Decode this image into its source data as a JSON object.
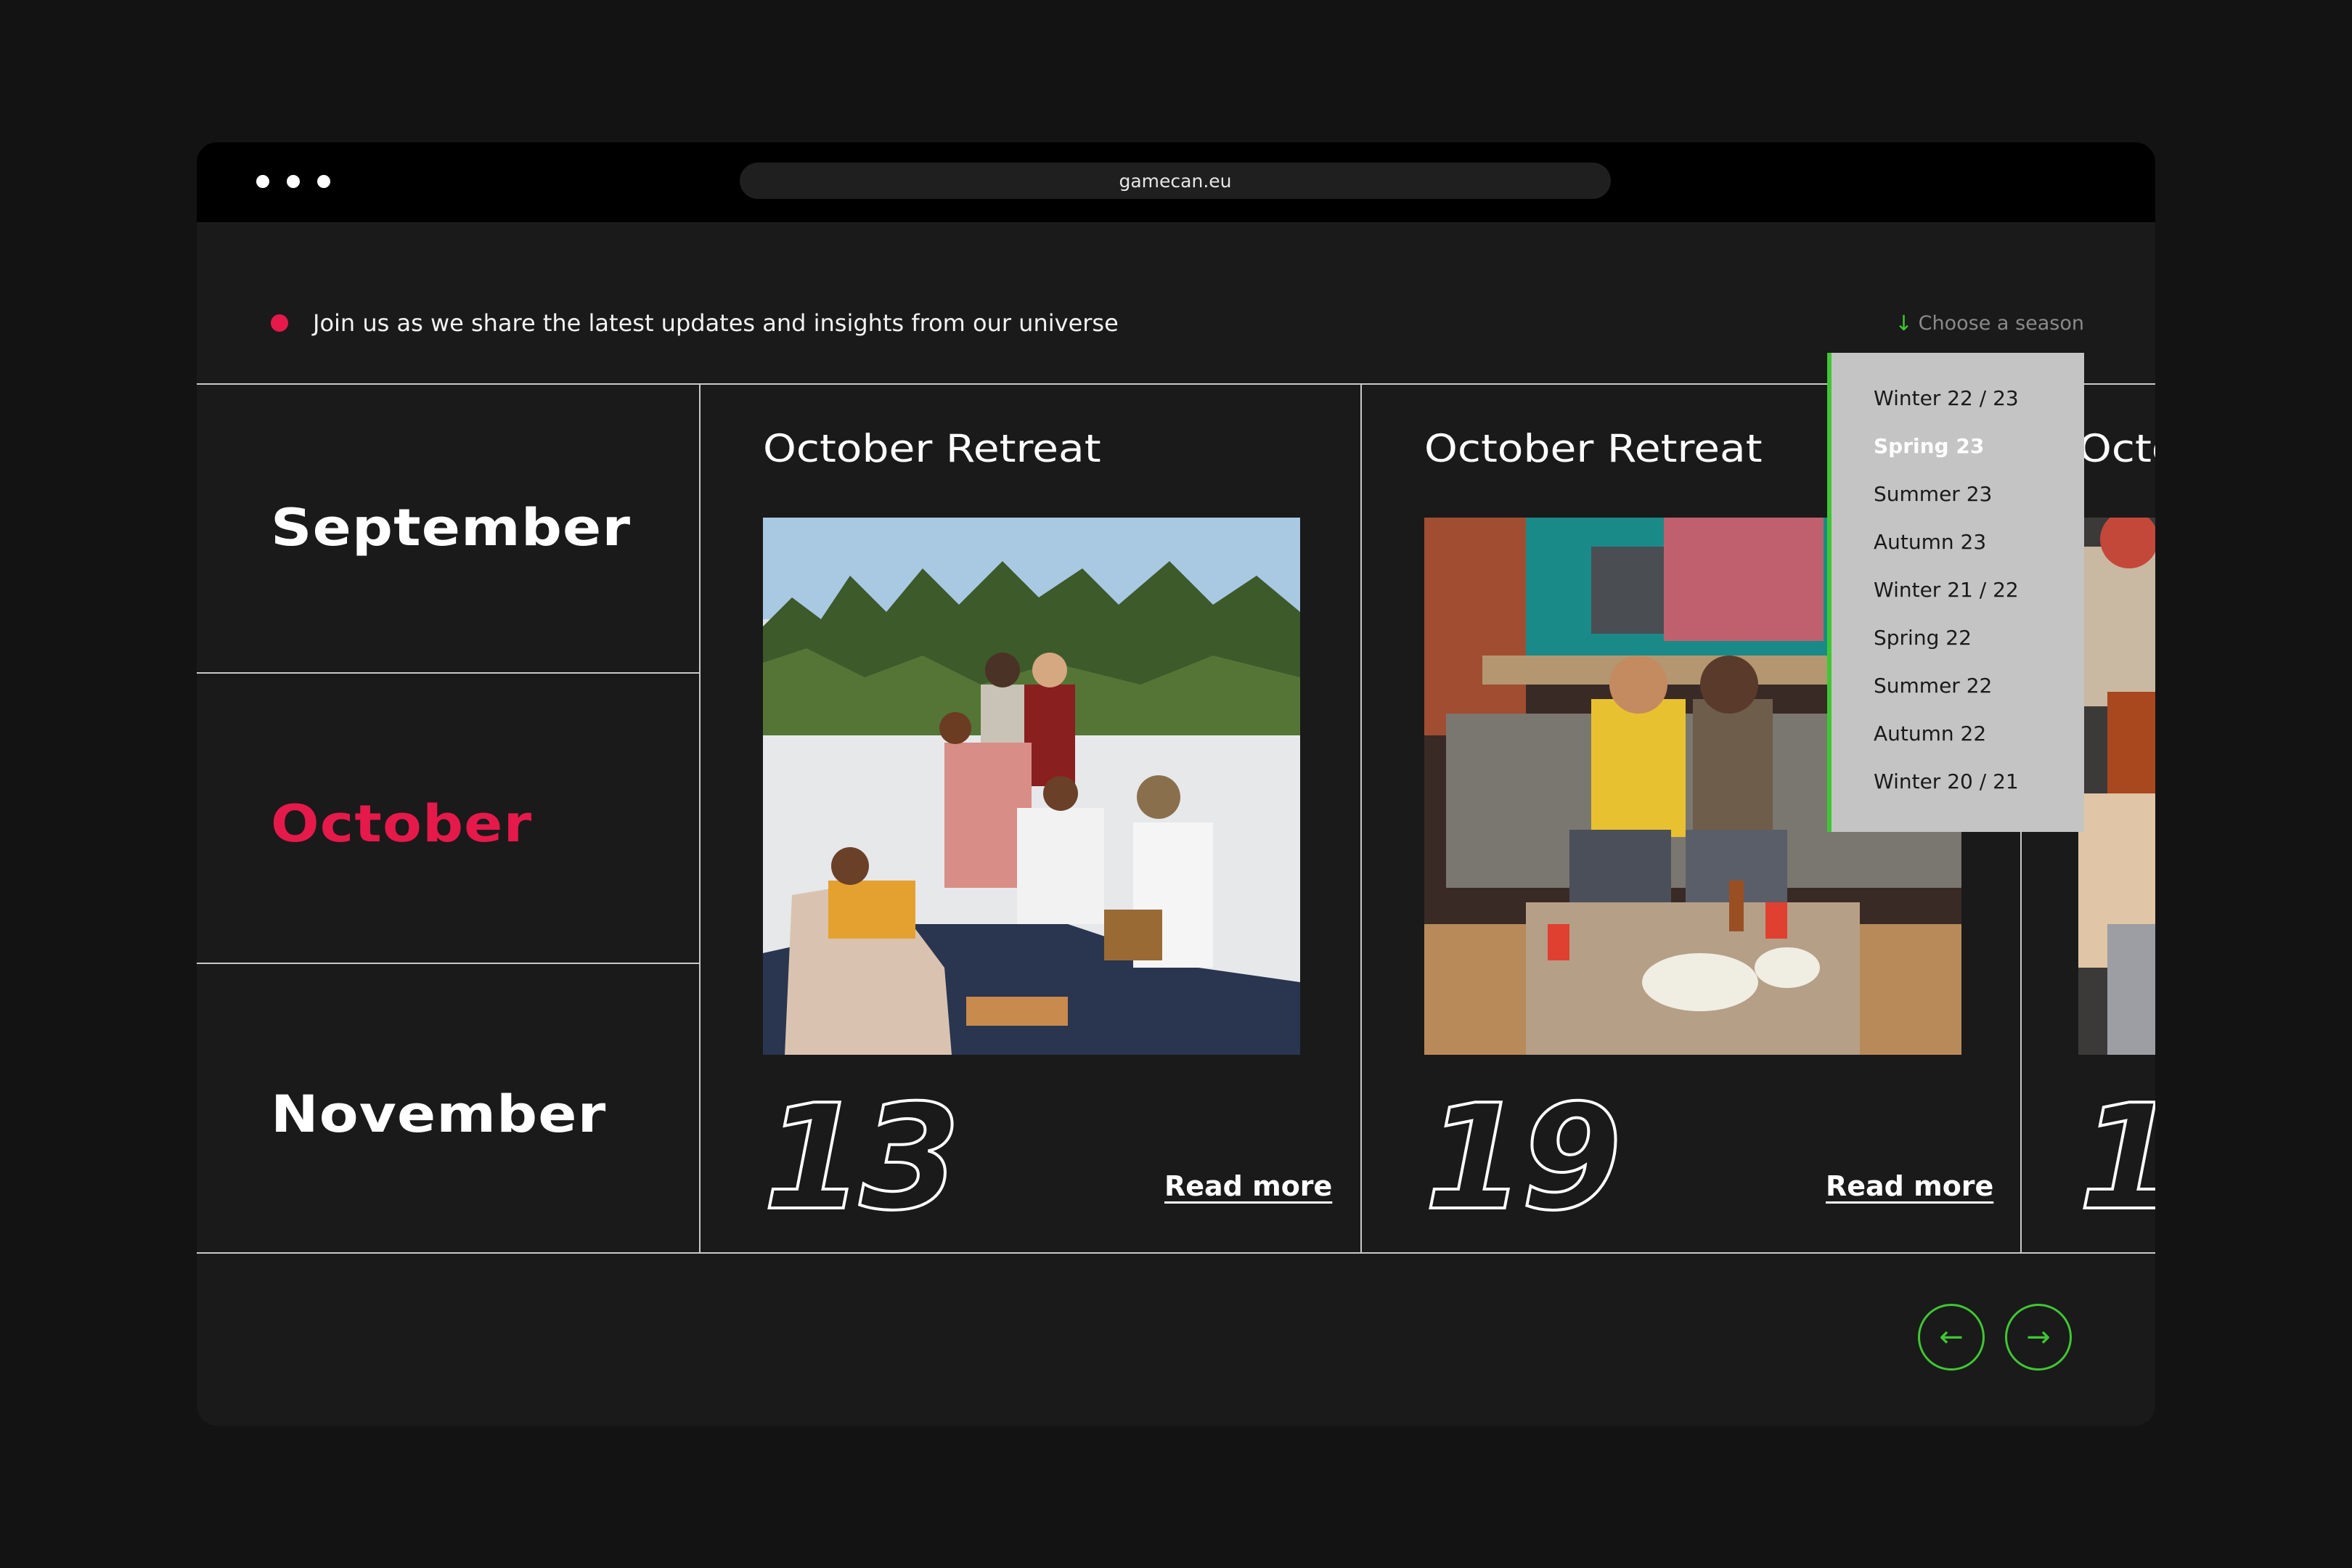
{
  "browser": {
    "url": "gamecan.eu"
  },
  "header": {
    "intro_text": "Join us as we share the latest updates and insights from our universe",
    "season_trigger": "Choose a season"
  },
  "months": [
    {
      "label": "September",
      "active": false
    },
    {
      "label": "October",
      "active": true
    },
    {
      "label": "November",
      "active": false
    }
  ],
  "cards": [
    {
      "title": "October Retreat",
      "day": "13",
      "link": "Read more",
      "image": "people picnic on sandy beach near pine forest"
    },
    {
      "title": "October Retreat",
      "day": "19",
      "link": "Read more",
      "image": "friends playing video games on couch"
    },
    {
      "title": "Octo",
      "day": "1",
      "image": "people at table with laptop"
    }
  ],
  "season_dropdown": {
    "options": [
      "Winter 22 / 23",
      "Spring 23",
      "Summer 23",
      "Autumn 23",
      "Winter 21 / 22",
      "Spring 22",
      "Summer 22",
      "Autumn 22",
      "Winter 20 / 21"
    ],
    "selected": "Spring 23"
  },
  "nav": {
    "prev_icon": "arrow-left-icon",
    "next_icon": "arrow-right-icon"
  },
  "colors": {
    "accent_red": "#e6194b",
    "accent_green": "#3fc733",
    "background": "#1a1a1a"
  }
}
